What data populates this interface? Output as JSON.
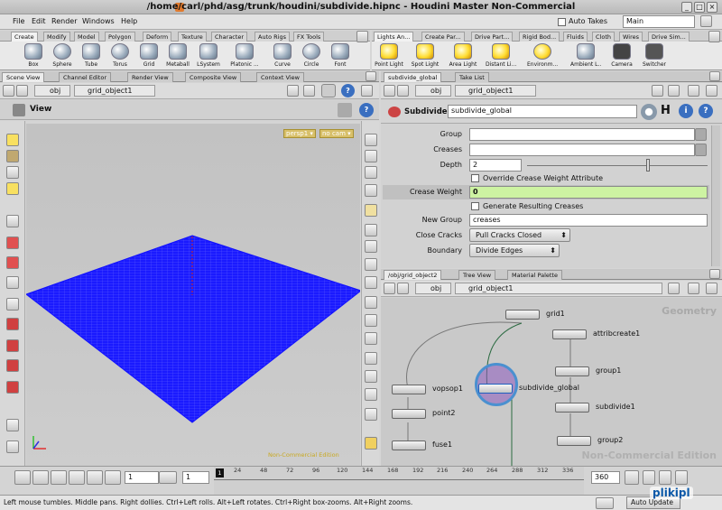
{
  "window": {
    "title": "/home/carl/phd/asg/trunk/houdini/subdivide.hipnc - Houdini Master Non-Commercial"
  },
  "menubar": {
    "items": [
      "File",
      "Edit",
      "Render",
      "Windows",
      "Help"
    ],
    "auto_takes_label": "Auto Takes",
    "desktop_value": "Main"
  },
  "shelf_left": {
    "tabs": [
      "Create",
      "Modify",
      "Model",
      "Polygon",
      "Deform",
      "Texture",
      "Character",
      "Auto Rigs",
      "FX Tools"
    ],
    "tools": [
      "Box",
      "Sphere",
      "Tube",
      "Torus",
      "Grid",
      "Metaball",
      "LSystem",
      "Platonic ...",
      "Curve",
      "Circle",
      "Font"
    ]
  },
  "shelf_right": {
    "tabs": [
      "Lights An...",
      "Create Par...",
      "Drive Part...",
      "Rigid Bod...",
      "Fluids",
      "Cloth",
      "Wires",
      "Drive Sim..."
    ],
    "tools": [
      "Point Light",
      "Spot Light",
      "Area Light",
      "Distant Li...",
      "Environm...",
      "Ambient L...",
      "Camera",
      "Switcher"
    ]
  },
  "viewer": {
    "tabs": [
      "Scene View",
      "Channel Editor",
      "Render View",
      "Composite View",
      "Context View"
    ],
    "path": [
      "obj",
      "grid_object1"
    ],
    "title": "View",
    "persp": "persp1",
    "cam": "no cam",
    "watermark": "Non-Commercial Edition",
    "grid_color": "#1010ff"
  },
  "params": {
    "tabs": [
      "subdivide_global",
      "Take List"
    ],
    "path": [
      "obj",
      "grid_object1"
    ],
    "node_type": "Subdivide",
    "node_name": "subdivide_global",
    "rows": {
      "group": {
        "label": "Group",
        "value": ""
      },
      "creases": {
        "label": "Creases",
        "value": ""
      },
      "depth": {
        "label": "Depth",
        "value": "2"
      },
      "override": {
        "label": "Override Crease Weight Attribute"
      },
      "crease_weight": {
        "label": "Crease Weight",
        "value": "0"
      },
      "generate": {
        "label": "Generate Resulting Creases"
      },
      "new_group": {
        "label": "New Group",
        "value": "creases"
      },
      "close_cracks": {
        "label": "Close Cracks",
        "value": "Pull Cracks Closed"
      },
      "boundary": {
        "label": "Boundary",
        "value": "Divide Edges"
      }
    }
  },
  "network": {
    "tabs": [
      "/obj/grid_object2",
      "Tree View",
      "Material Palette"
    ],
    "path": [
      "obj",
      "grid_object1"
    ],
    "context_label": "Geometry",
    "watermark": "Non-Commercial Edition",
    "nodes": [
      "grid1",
      "attribcreate1",
      "group1",
      "subdivide_global",
      "subdivide1",
      "group2",
      "vopsop1",
      "point2",
      "fuse1"
    ]
  },
  "playbar": {
    "frame": "1",
    "frame2": "1",
    "start_marker": "1",
    "end_frame": "360",
    "ticks": [
      "24",
      "48",
      "72",
      "96",
      "120",
      "144",
      "168",
      "192",
      "216",
      "240",
      "264",
      "288",
      "312",
      "336"
    ],
    "auto_update": "Auto Update"
  },
  "status": {
    "text": "Left mouse tumbles. Middle pans. Right dollies. Ctrl+Left rolls. Alt+Left rotates. Ctrl+Right box-zooms. Alt+Right zooms."
  },
  "logo": {
    "text": "plikipl"
  }
}
